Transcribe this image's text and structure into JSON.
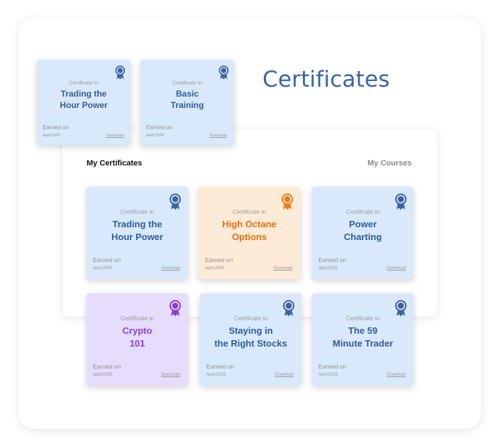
{
  "page": {
    "title": "Certificates"
  },
  "tabs": {
    "active": "My Certificates",
    "inactive": "My Courses"
  },
  "colors": {
    "blue": "#3a64a8",
    "orange": "#ef7a16",
    "purple": "#8a3fe0"
  },
  "featured": [
    {
      "label": "Certificate in",
      "line1": "Trading the",
      "line2": "Hour Power",
      "earned": "Earned on",
      "date": "April,2025",
      "download": "Download",
      "theme": "blue",
      "icon": "award-ribbon-icon"
    },
    {
      "label": "Certificate in",
      "line1": "Basic",
      "line2": "Training",
      "earned": "Earned on",
      "date": "April,2025",
      "download": "Download",
      "theme": "blue",
      "icon": "award-ribbon-icon"
    }
  ],
  "certificates": [
    {
      "label": "Certificate in",
      "line1": "Trading the",
      "line2": "Hour Power",
      "earned": "Earned on",
      "date": "April,2025",
      "download": "Download",
      "theme": "blue",
      "icon": "award-ribbon-icon"
    },
    {
      "label": "Certificate in",
      "line1": "High Octane",
      "line2": "Options",
      "earned": "Earned on",
      "date": "April,2025",
      "download": "Download",
      "theme": "orange",
      "icon": "award-ribbon-icon"
    },
    {
      "label": "Certificate in",
      "line1": "Power",
      "line2": "Charting",
      "earned": "Earned on",
      "date": "April,2025",
      "download": "Download",
      "theme": "blue",
      "icon": "award-ribbon-icon"
    },
    {
      "label": "Certificate in",
      "line1": "Crypto",
      "line2": "101",
      "earned": "Earned on",
      "date": "April,2025",
      "download": "Download",
      "theme": "purple",
      "icon": "award-ribbon-icon"
    },
    {
      "label": "Certificate in",
      "line1": "Staying in",
      "line2": "the Right Stocks",
      "earned": "Earned on",
      "date": "April,2025",
      "download": "Download",
      "theme": "blue",
      "icon": "award-ribbon-icon"
    },
    {
      "label": "Certificate in",
      "line1": "The 59",
      "line2": "Minute Trader",
      "earned": "Earned on",
      "date": "April,2025",
      "download": "Download",
      "theme": "blue",
      "icon": "award-ribbon-icon"
    }
  ]
}
